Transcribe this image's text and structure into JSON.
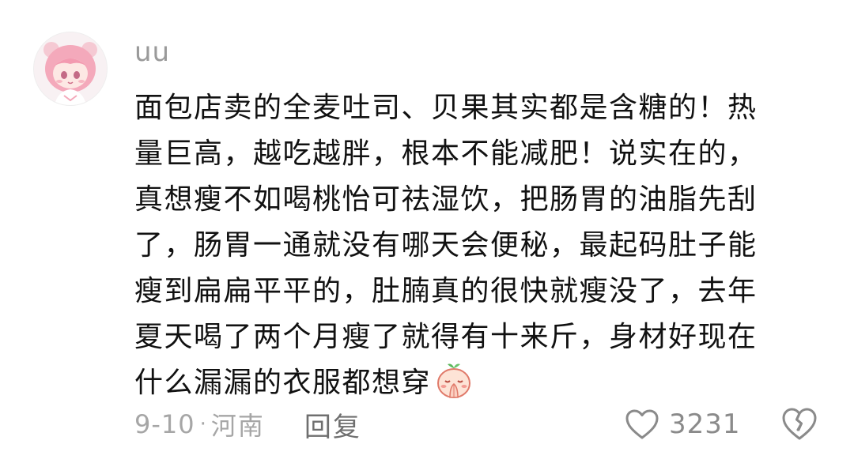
{
  "comment": {
    "username": "uu",
    "text_lines": [
      "面包店卖的全麦吐司、贝果其实都是含糖的！热",
      "量巨高，越吃越胖，根本不能减肥！说实在的，",
      "真想瘦不如喝桃怡可祛湿饮，把肠胃的油脂先刮",
      "了，肠胃一通就没有哪天会便秘，最起码肚子能",
      "瘦到扁扁平平的，肚腩真的很快就瘦没了，去年",
      "夏天喝了两个月瘦了就得有十来斤，身材好现在",
      "什么漏漏的衣服都想穿"
    ],
    "inline_emoji": "praying-face-emoji",
    "date": "9-10",
    "separator": "·",
    "location": "河南",
    "reply_label": "回复",
    "like_count": "3231",
    "icons": {
      "like": "heart-outline-icon",
      "dislike": "broken-heart-icon"
    }
  },
  "colors": {
    "meta_text": "#a6a6a6",
    "username": "#9a9a9a",
    "body_text": "#111111",
    "icon_gray": "#8a8a8a"
  }
}
